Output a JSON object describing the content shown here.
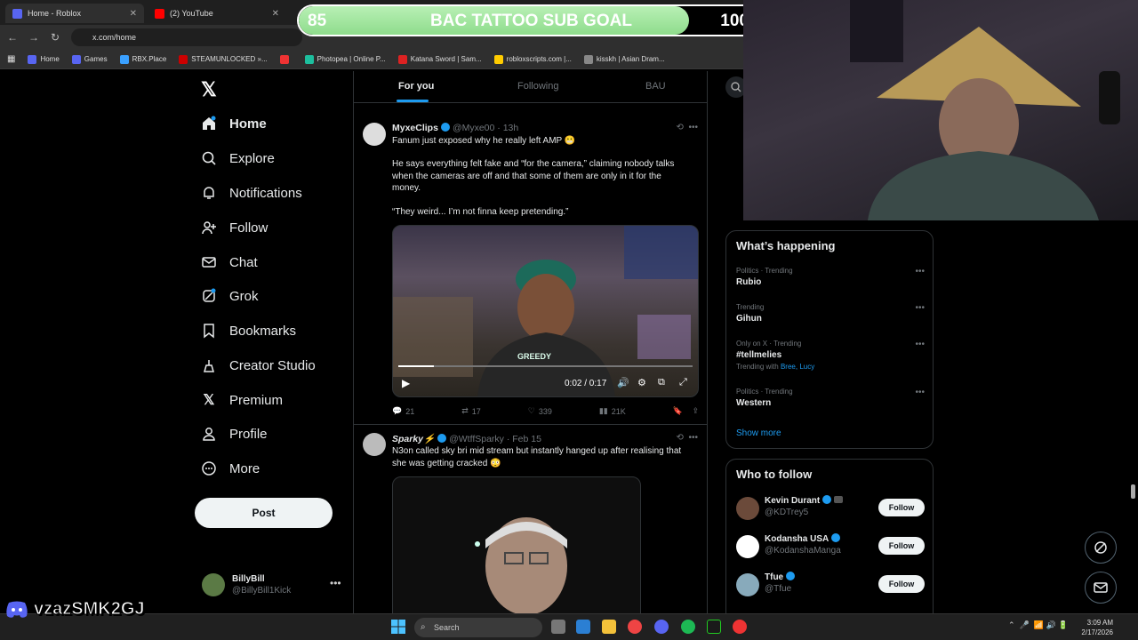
{
  "browser": {
    "tabs": [
      {
        "title": "Home - Roblox",
        "active": true
      },
      {
        "title": "(2) YouTube",
        "active": false
      }
    ],
    "url": "x.com/home",
    "bookmarks": [
      "Home",
      "Games",
      "RBX.Place",
      "STEAMUNLOCKED »...",
      "",
      "Photopea | Online P...",
      "Katana Sword | Sam...",
      "robloxscripts.com |...",
      "kisskh | Asian Dram..."
    ]
  },
  "overlay": {
    "goal_current": "85",
    "goal_title": "BAC TATTOO SUB GOAL",
    "goal_target": "100",
    "goal_progress": 0.85,
    "discord_name": "vzazSMK2GJ"
  },
  "nav": {
    "items": [
      "Home",
      "Explore",
      "Notifications",
      "Follow",
      "Chat",
      "Grok",
      "Bookmarks",
      "Creator Studio",
      "Premium",
      "Profile",
      "More"
    ],
    "post_label": "Post",
    "account_name": "BillyBill",
    "account_handle": "@BillyBill1Kick"
  },
  "feed": {
    "tabs": [
      "For you",
      "Following",
      "BAU"
    ],
    "tweets": [
      {
        "name": "MyxeClips",
        "handle": "@Myxe00",
        "time": "13h",
        "text1": "Fanum just exposed why he really left AMP 😬",
        "text2": "He says everything felt fake and “for the camera,” claiming nobody talks when the cameras are off and that some of them are only in it for the money.",
        "text3": "“They weird... I’m not finna keep pretending.”",
        "video_time": "0:02 / 0:17",
        "shirt_text": "GREEDY",
        "replies": "21",
        "reposts": "17",
        "likes": "339",
        "views": "21K"
      },
      {
        "name": "Sparky⚡",
        "handle": "@WtffSparky",
        "time": "Feb 15",
        "text1": "N3on called sky bri mid stream but instantly hanged up after realising that she was getting cracked 😳"
      }
    ]
  },
  "trends": {
    "title": "What’s happening",
    "items": [
      {
        "cat": "Politics · Trending",
        "name": "Rubio",
        "with": ""
      },
      {
        "cat": "Trending",
        "name": "Gihun",
        "with": ""
      },
      {
        "cat": "Only on X · Trending",
        "name": "#tellmelies",
        "with_label": "Trending with",
        "with": "Bree, Lucy"
      },
      {
        "cat": "Politics · Trending",
        "name": "Western",
        "with": ""
      }
    ],
    "show_more": "Show more"
  },
  "who_to_follow": {
    "title": "Who to follow",
    "items": [
      {
        "name": "Kevin Durant",
        "handle": "@KDTrey5"
      },
      {
        "name": "Kodansha USA",
        "handle": "@KodanshaManga"
      },
      {
        "name": "Tfue",
        "handle": "@Tfue"
      }
    ],
    "follow_label": "Follow"
  },
  "taskbar": {
    "search": "Search",
    "time": "3:09 AM",
    "date": "2/17/2026"
  }
}
